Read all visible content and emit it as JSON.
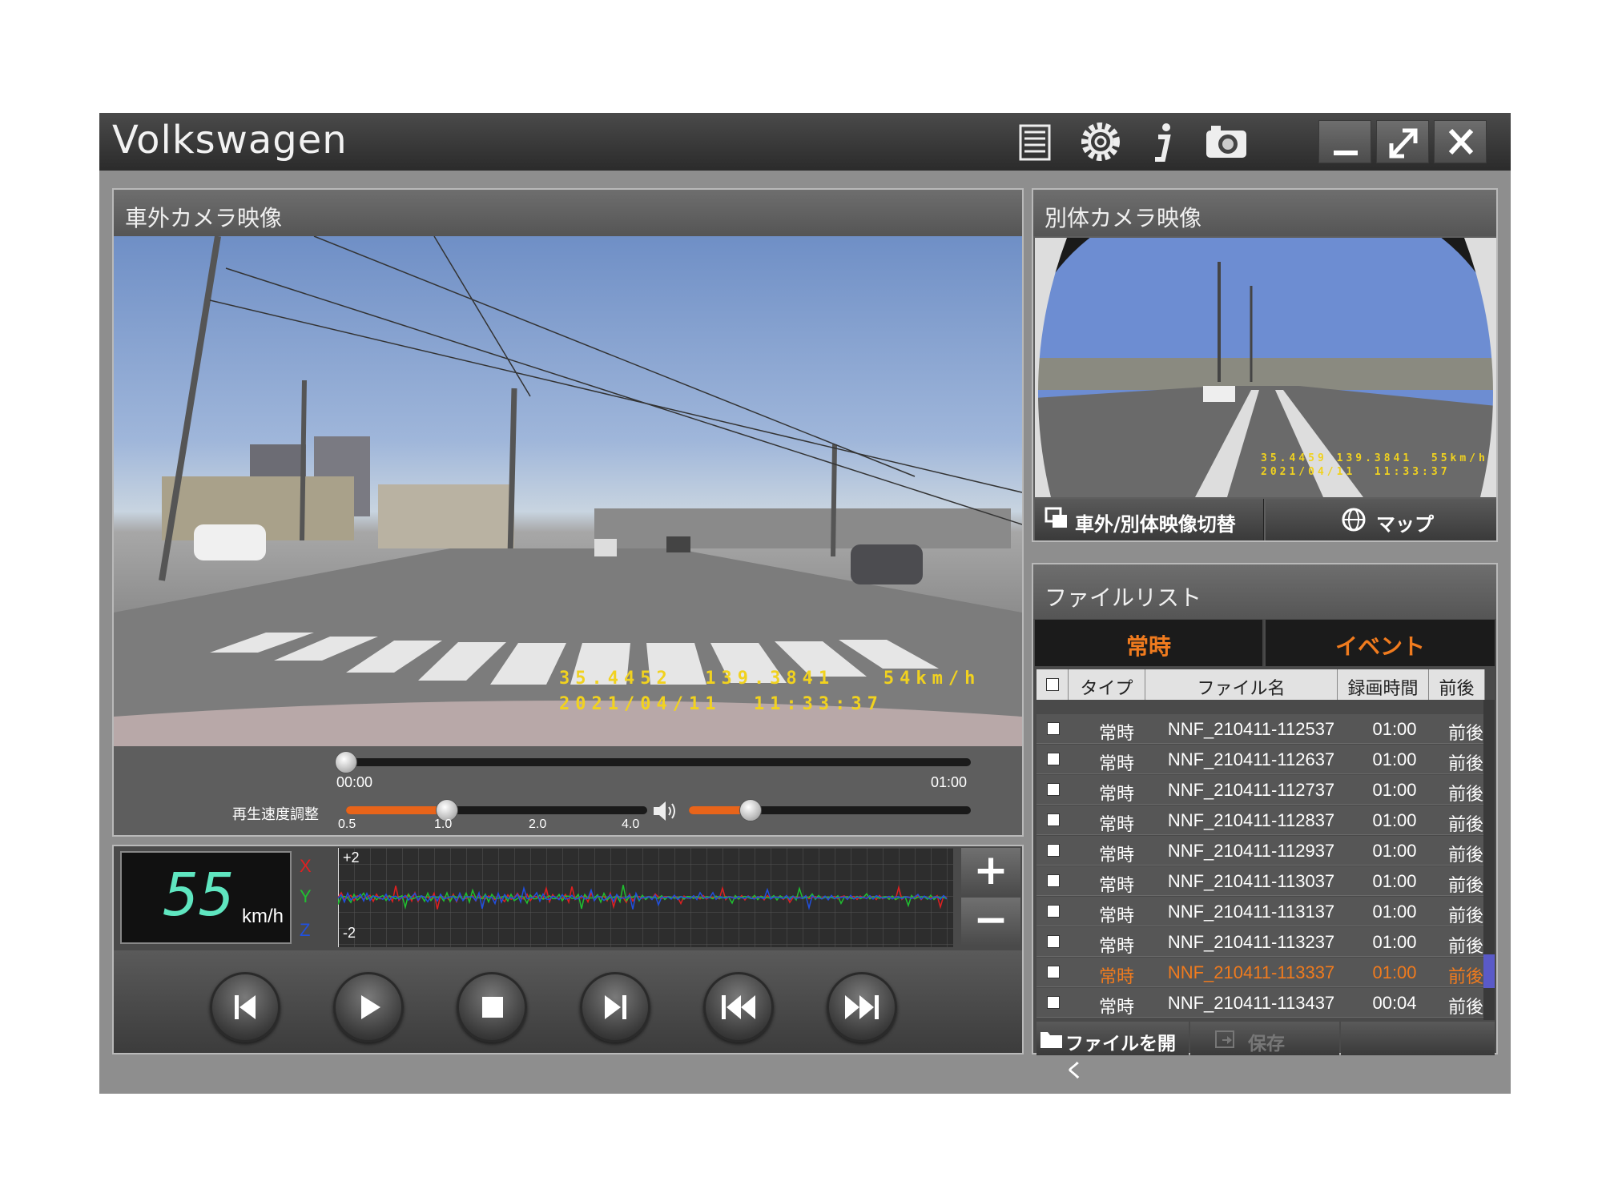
{
  "app": {
    "title": "Volkswagen"
  },
  "main_panel": {
    "title": "車外カメラ映像",
    "osd_line1": "35.4452  139.3841   54km/h",
    "osd_line2": "2021/04/11  11:33:37",
    "seek": {
      "start": "00:00",
      "end": "01:00",
      "position_fraction": 0.0
    },
    "speed_adjust": {
      "label": "再生速度調整",
      "ticks": [
        "0.5",
        "1.0",
        "2.0",
        "4.0"
      ],
      "value": "1.0"
    },
    "volume_fraction": 0.22
  },
  "sensor": {
    "speed": "55",
    "unit": "km/h",
    "axes": [
      "X",
      "Y",
      "Z"
    ],
    "scale_top": "+2",
    "scale_bottom": "-2",
    "zoom_in": "+",
    "zoom_out": "−"
  },
  "controls": [
    "skip-to-start",
    "play",
    "stop",
    "frame-forward",
    "rewind",
    "fast-forward"
  ],
  "sub_panel": {
    "title": "別体カメラ映像",
    "osd_line1": "35.4459 139.3841  55km/h",
    "osd_line2": "2021/04/11  11:33:37",
    "switch_button": "車外/別体映像切替",
    "map_button": "マップ"
  },
  "file_list": {
    "title": "ファイルリスト",
    "tabs": [
      "常時",
      "イベント"
    ],
    "columns": [
      "タイプ",
      "ファイル名",
      "録画時間",
      "前後"
    ],
    "rows": [
      {
        "type": "常時",
        "name": "NNF_210411-112537",
        "time": "01:00",
        "pre": "前後"
      },
      {
        "type": "常時",
        "name": "NNF_210411-112637",
        "time": "01:00",
        "pre": "前後"
      },
      {
        "type": "常時",
        "name": "NNF_210411-112737",
        "time": "01:00",
        "pre": "前後"
      },
      {
        "type": "常時",
        "name": "NNF_210411-112837",
        "time": "01:00",
        "pre": "前後"
      },
      {
        "type": "常時",
        "name": "NNF_210411-112937",
        "time": "01:00",
        "pre": "前後"
      },
      {
        "type": "常時",
        "name": "NNF_210411-113037",
        "time": "01:00",
        "pre": "前後"
      },
      {
        "type": "常時",
        "name": "NNF_210411-113137",
        "time": "01:00",
        "pre": "前後"
      },
      {
        "type": "常時",
        "name": "NNF_210411-113237",
        "time": "01:00",
        "pre": "前後"
      },
      {
        "type": "常時",
        "name": "NNF_210411-113337",
        "time": "01:00",
        "pre": "前後"
      },
      {
        "type": "常時",
        "name": "NNF_210411-113437",
        "time": "00:04",
        "pre": "前後"
      }
    ],
    "selected_index": 8,
    "open_button": "ファイルを開く",
    "save_button": "保存"
  },
  "colors": {
    "accent": "#f07b1e",
    "x_axis": "#e02020",
    "y_axis": "#20c030",
    "z_axis": "#2050e0",
    "speed": "#5fe6c0"
  }
}
